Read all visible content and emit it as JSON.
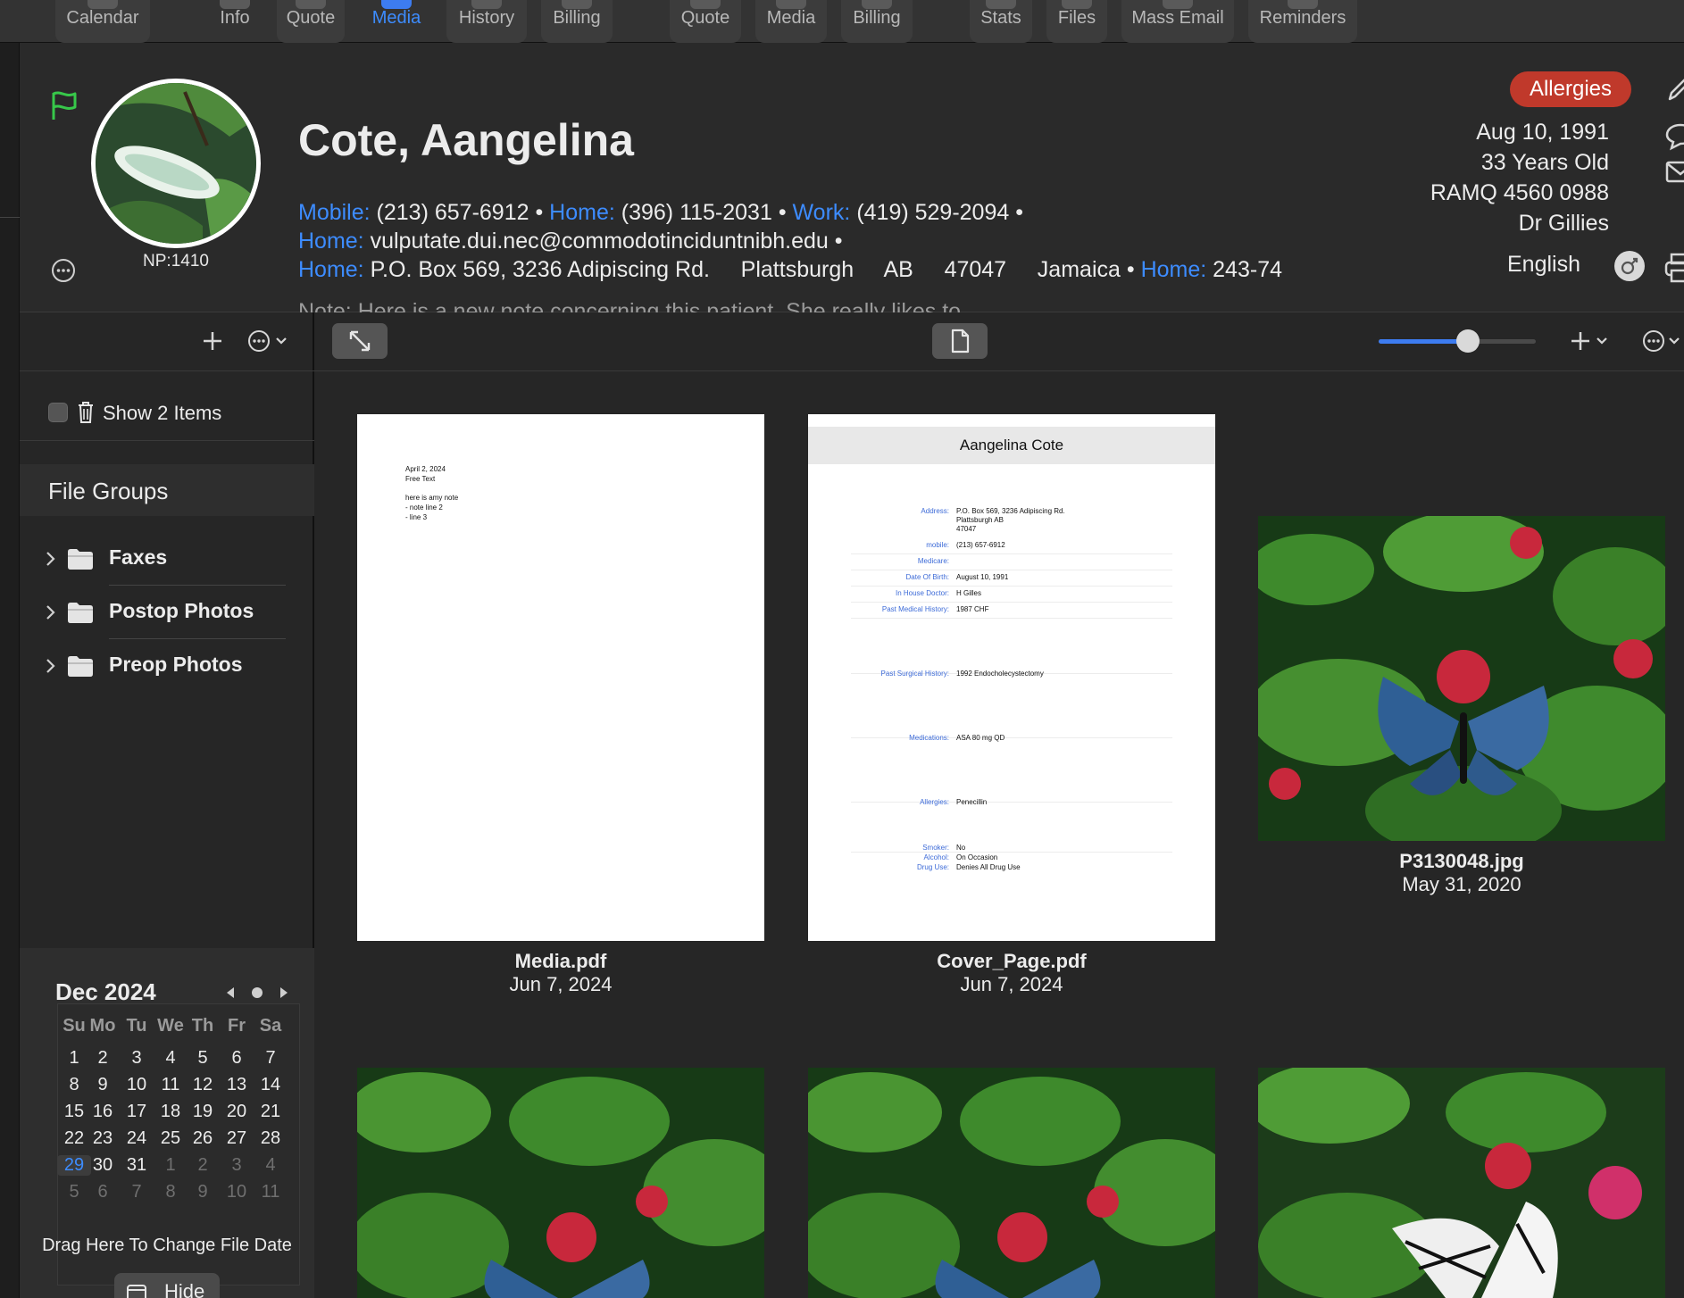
{
  "toolbar": {
    "items": [
      {
        "label": "Calendar"
      },
      {
        "label": "Info"
      },
      {
        "label": "Quote"
      },
      {
        "label": "Media"
      },
      {
        "label": "History"
      },
      {
        "label": "Billing"
      },
      {
        "label": "Quote"
      },
      {
        "label": "Media"
      },
      {
        "label": "Billing"
      },
      {
        "label": "Stats"
      },
      {
        "label": "Files"
      },
      {
        "label": "Mass Email"
      },
      {
        "label": "Reminders"
      }
    ],
    "active": "Media"
  },
  "patient": {
    "name": "Cote, Aangelina",
    "np": "NP:1410",
    "phones": [
      {
        "label": "Mobile:",
        "value": "(213) 657-6912"
      },
      {
        "label": "Home:",
        "value": "(396) 115-2031"
      },
      {
        "label": "Work:",
        "value": "(419) 529-2094"
      }
    ],
    "email": {
      "label": "Home:",
      "value": "vulputate.dui.nec@commodotinciduntnibh.edu"
    },
    "address": {
      "label": "Home:",
      "value": "P.O. Box 569, 3236 Adipiscing Rd.     Plattsburgh     AB     47047     Jamaica",
      "extra_label": "Home:",
      "extra_value": "243-74"
    },
    "note": "Note: Here is a new note concerning this patient. She really likes to ...",
    "allergies_badge": "Allergies",
    "dob": "Aug 10, 1991",
    "age": "33 Years Old",
    "ramq": "RAMQ 4560 0988",
    "doctor": "Dr Gillies",
    "language": "English"
  },
  "sidebar": {
    "show_label": "Show 2 Items",
    "file_groups_title": "File Groups",
    "groups": [
      {
        "label": "Faxes"
      },
      {
        "label": "Postop Photos"
      },
      {
        "label": "Preop Photos"
      }
    ],
    "calendar": {
      "title": "Dec 2024",
      "days_header": [
        "Su",
        "Mo",
        "Tu",
        "We",
        "Th",
        "Fr",
        "Sa"
      ],
      "weeks": [
        [
          "",
          "1",
          "2",
          "3",
          "4",
          "5",
          "6",
          "7"
        ],
        [
          "",
          "8",
          "9",
          "10",
          "11",
          "12",
          "13",
          "14"
        ],
        [
          "",
          "15",
          "16",
          "17",
          "18",
          "19",
          "20",
          "21"
        ],
        [
          "",
          "22",
          "23",
          "24",
          "25",
          "26",
          "27",
          "28"
        ],
        [
          "",
          "29",
          "30",
          "31",
          "1",
          "2",
          "3",
          "4"
        ],
        [
          "",
          "5",
          "6",
          "7",
          "8",
          "9",
          "10",
          "11"
        ]
      ],
      "today": "29"
    },
    "drag_hint": "Drag Here To Change File Date",
    "hide_label": "Hide"
  },
  "media": {
    "zoom_percent": 57,
    "files": [
      {
        "name": "Media.pdf",
        "date": "Jun 7, 2024"
      },
      {
        "name": "Cover_Page.pdf",
        "date": "Jun 7, 2024"
      },
      {
        "name": "P3130048.jpg",
        "date": "May 31, 2020"
      }
    ],
    "media_doc": {
      "date": "April 2, 2024",
      "title": "Free Text",
      "lines": [
        "here is amy note",
        "- note line 2",
        "- line 3"
      ]
    },
    "cover_doc": {
      "header": "Aangelina Cote",
      "rows": [
        {
          "k": "Address:",
          "v": "P.O. Box 569, 3236 Adipiscing Rd."
        },
        {
          "k": "",
          "v": "Plattsburgh AB"
        },
        {
          "k": "",
          "v": "47047"
        },
        {
          "k": "mobile:",
          "v": "(213) 657-6912"
        },
        {
          "k": "Medicare:",
          "v": ""
        },
        {
          "k": "Date Of Birth:",
          "v": "August 10, 1991"
        },
        {
          "k": "In House Doctor:",
          "v": "H Gilles"
        },
        {
          "k": "Past Medical History:",
          "v": "1987 CHF"
        },
        {
          "k": "Past Surgical History:",
          "v": "1992 Endocholecystectomy"
        },
        {
          "k": "Medications:",
          "v": "ASA 80 mg QD"
        },
        {
          "k": "Allergies:",
          "v": "Penecillin"
        },
        {
          "k": "Smoker:",
          "v": "No"
        },
        {
          "k": "Alcohol:",
          "v": "On Occasion"
        },
        {
          "k": "Drug Use:",
          "v": "Denies All Drug Use"
        }
      ]
    }
  }
}
